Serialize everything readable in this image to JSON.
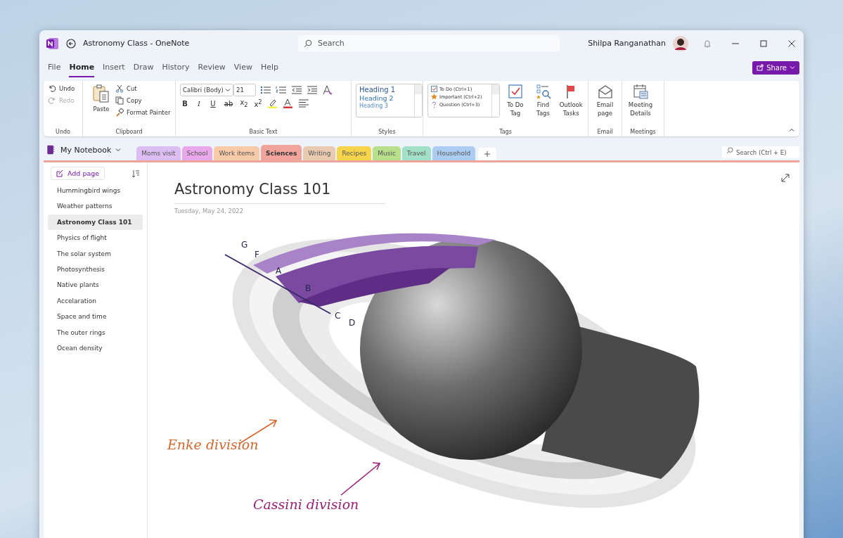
{
  "window": {
    "title": "Astronomy Class - OneNote",
    "search_placeholder": "Search",
    "user": "Shilpa Ranganathan"
  },
  "menu_tabs": [
    {
      "label": "File",
      "selected": false
    },
    {
      "label": "Home",
      "selected": true
    },
    {
      "label": "Insert",
      "selected": false
    },
    {
      "label": "Draw",
      "selected": false
    },
    {
      "label": "History",
      "selected": false
    },
    {
      "label": "Review",
      "selected": false
    },
    {
      "label": "View",
      "selected": false
    },
    {
      "label": "Help",
      "selected": false
    }
  ],
  "share": "Share",
  "ribbon": {
    "undo_group": {
      "label": "Undo",
      "undo": {
        "label": "Undo",
        "disabled": false
      },
      "redo": {
        "label": "Redo",
        "disabled": true
      }
    },
    "clipboard": {
      "label": "Clipboard",
      "paste": "Paste",
      "cut": "Cut",
      "copy": "Copy",
      "format_painter": "Format Painter"
    },
    "basic_text": {
      "label": "Basic Text",
      "font": "Calibri (Body)",
      "size": "21",
      "bold": "B",
      "italic": "I",
      "underline": "U",
      "strike": "ab",
      "subscript": "x$_{2}$",
      "superscript": "x$^{2}$"
    },
    "styles": {
      "label": "Styles",
      "items": [
        "Heading 1",
        "Heading 2",
        "Heading 3"
      ]
    },
    "tags": {
      "label": "Tags",
      "items": [
        {
          "kind": "todo",
          "label": "To Do (Ctrl+1)"
        },
        {
          "kind": "important",
          "label": "Important (Ctrl+2)"
        },
        {
          "kind": "question",
          "label": "Question (Ctrl+3)"
        }
      ],
      "buttons": [
        {
          "kind": "todo",
          "label": "To Do Tag"
        },
        {
          "kind": "find",
          "label": "Find Tags"
        },
        {
          "kind": "flag",
          "label": "Outlook Tasks"
        }
      ]
    },
    "email": {
      "label": "Email",
      "button": "Email page"
    },
    "meetings": {
      "label": "Meetings",
      "button": "Meeting Details"
    }
  },
  "notebook": "My Notebook",
  "sections": [
    {
      "label": "Moms visit",
      "color": "#dcbef2",
      "selected": false
    },
    {
      "label": "School",
      "color": "#e8a8ea",
      "selected": false
    },
    {
      "label": "Work items",
      "color": "#f7caa8",
      "selected": false
    },
    {
      "label": "Sciences",
      "color": "#f0a49c",
      "selected": true
    },
    {
      "label": "Writing",
      "color": "#e9cbb2",
      "selected": false
    },
    {
      "label": "Recipes",
      "color": "#f6d54c",
      "selected": false
    },
    {
      "label": "Music",
      "color": "#b8e08c",
      "selected": false
    },
    {
      "label": "Travel",
      "color": "#a2e0c9",
      "selected": false
    },
    {
      "label": "Household",
      "color": "#abcdf2",
      "selected": false
    }
  ],
  "section_search_placeholder": "Search (Ctrl + E)",
  "add_page": "Add page",
  "pages": [
    {
      "label": "Hummingbird wings",
      "selected": false
    },
    {
      "label": "Weather patterns",
      "selected": false
    },
    {
      "label": "Astronomy Class 101",
      "selected": true
    },
    {
      "label": "Physics of flight",
      "selected": false
    },
    {
      "label": "The solar system",
      "selected": false
    },
    {
      "label": "Photosynthesis",
      "selected": false
    },
    {
      "label": "Native plants",
      "selected": false
    },
    {
      "label": "Accelaration",
      "selected": false
    },
    {
      "label": "Space and time",
      "selected": false
    },
    {
      "label": "The outer rings",
      "selected": false
    },
    {
      "label": "Ocean density",
      "selected": false
    }
  ],
  "page": {
    "title": "Astronomy Class 101",
    "date": "Tuesday, May 24, 2022",
    "ring_labels": [
      "G",
      "F",
      "A",
      "B",
      "C",
      "D"
    ],
    "annotations": [
      {
        "label": "Enke division",
        "color": "#d8652a"
      },
      {
        "label": "Cassini division",
        "color": "#9a1f78"
      }
    ]
  }
}
